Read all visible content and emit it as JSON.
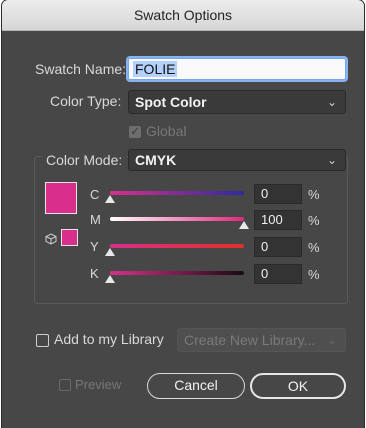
{
  "title": "Swatch Options",
  "swatch_name": {
    "label": "Swatch Name:",
    "value": "FOLIE"
  },
  "color_type": {
    "label": "Color Type:",
    "value": "Spot Color"
  },
  "global": {
    "label": "Global",
    "checked": true,
    "enabled": false
  },
  "color_mode": {
    "label": "Color Mode:",
    "value": "CMYK"
  },
  "swatch_color": "#d92f8a",
  "sliders": [
    {
      "label": "C",
      "value": "0",
      "unit": "%",
      "gradient": "#d92f8a → #2e2aa0"
    },
    {
      "label": "M",
      "value": "100",
      "unit": "%",
      "gradient": "#ffffff → #e0287f"
    },
    {
      "label": "Y",
      "value": "0",
      "unit": "%",
      "gradient": "#d92f8a → #e0302a"
    },
    {
      "label": "K",
      "value": "0",
      "unit": "%",
      "gradient": "#d92f8a → #1a0a12"
    }
  ],
  "library": {
    "label": "Add to my Library",
    "checked": false,
    "dropdown": "Create New Library..."
  },
  "preview": {
    "label": "Preview",
    "checked": false,
    "enabled": false
  },
  "buttons": {
    "cancel": "Cancel",
    "ok": "OK"
  },
  "icons": {
    "chevron": "chevron-down-icon",
    "gamut": "3d-cube-icon",
    "slider_thumb": "triangle-up-icon"
  }
}
